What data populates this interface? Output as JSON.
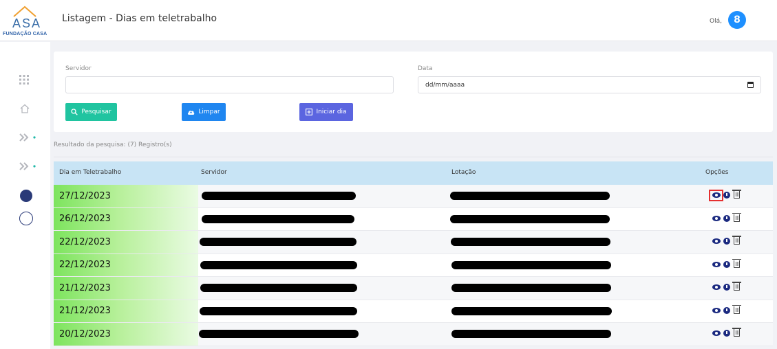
{
  "brand": {
    "logo_word": "ASA",
    "logo_caption": "FUNDAÇÃO CASA",
    "accent": "#3a6ea8"
  },
  "header": {
    "title": "Listagem - Dias em teletrabalho",
    "greeting": "Olá,",
    "avatar_icon": "user-icon",
    "avatar_glyph": "8"
  },
  "sidebar": {
    "items": [
      "grid-icon",
      "home-icon",
      "double-chevron-icon",
      "double-chevron-icon",
      "filled-circle",
      "empty-circle"
    ]
  },
  "filters": {
    "servidor_label": "Servidor",
    "servidor_value": "",
    "data_label": "Data",
    "data_placeholder": "dd/mm/aaaa",
    "buttons": {
      "search": "Pesquisar",
      "clear": "Limpar",
      "start": "Iniciar dia"
    }
  },
  "result_text": "Resultado da pesquisa: (7) Registro(s)",
  "table": {
    "headers": {
      "day": "Dia em Teletrabalho",
      "servidor": "Servidor",
      "lotacao": "Lotação",
      "options": "Opções"
    },
    "rows": [
      {
        "date": "27/12/2023"
      },
      {
        "date": "26/12/2023"
      },
      {
        "date": "22/12/2023"
      },
      {
        "date": "22/12/2023"
      },
      {
        "date": "21/12/2023"
      },
      {
        "date": "21/12/2023"
      },
      {
        "date": "20/12/2023"
      }
    ]
  },
  "colors": {
    "search_btn": "#20c4a0",
    "clear_btn": "#1f86f0",
    "start_btn": "#5b65e0",
    "table_header": "#c8e4f5",
    "date_cell": "#7de45e"
  }
}
